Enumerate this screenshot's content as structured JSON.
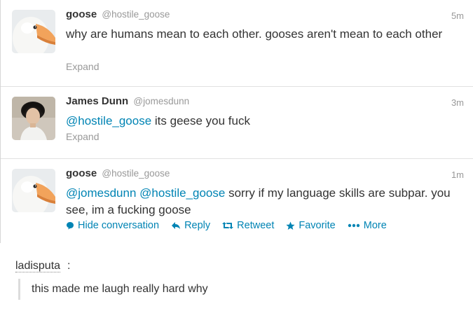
{
  "tweets": [
    {
      "fullname": "goose",
      "username": "@hostile_goose",
      "time": "5m",
      "text": "why are humans mean to each other. gooses aren't mean to each other",
      "expand": "Expand"
    },
    {
      "fullname": "James Dunn",
      "username": "@jomesdunn",
      "time": "3m",
      "mention": "@hostile_goose",
      "text": " its geese you fuck",
      "expand": "Expand"
    },
    {
      "fullname": "goose",
      "username": "@hostile_goose",
      "time": "1m",
      "mention1": "@jomesdunn",
      "mention2": "@hostile_goose",
      "text": " sorry if my language skills are subpar. you see, im a fucking goose",
      "actions": {
        "hide": "Hide conversation",
        "reply": "Reply",
        "retweet": "Retweet",
        "favorite": "Favorite",
        "more": "More"
      }
    }
  ],
  "reblog": {
    "user": "ladisputa",
    "colon": ":",
    "comment": "this made me laugh really hard why"
  },
  "colors": {
    "link": "#0084b4",
    "muted": "#999999",
    "text": "#333333"
  },
  "icons": [
    "goose-avatar",
    "person-avatar",
    "speech-bubble-icon",
    "reply-arrow-icon",
    "retweet-icon",
    "star-icon",
    "ellipsis-icon"
  ]
}
